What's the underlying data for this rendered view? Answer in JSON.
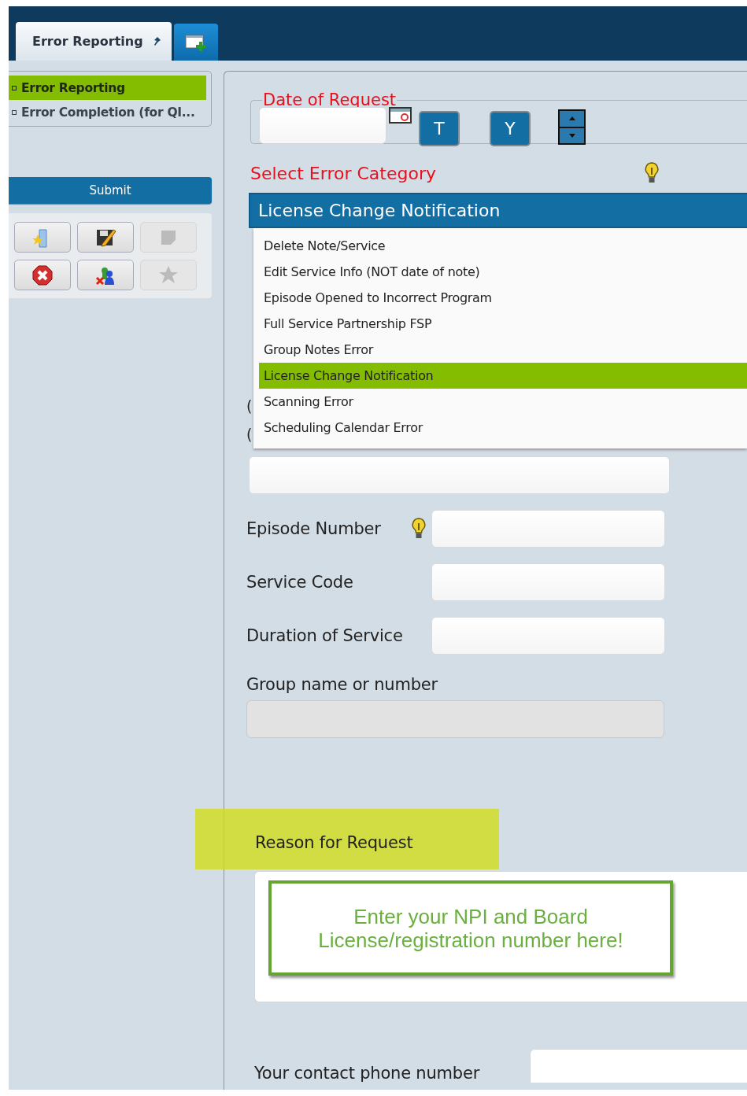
{
  "tabs": [
    {
      "label": "Error Reporting",
      "selected": true,
      "pinned": true
    }
  ],
  "nav": {
    "items": [
      {
        "label": "Error Reporting",
        "selected": true
      },
      {
        "label": "Error Completion (for QI...",
        "selected": false
      }
    ]
  },
  "submit_button": "Submit",
  "toolbar": [
    {
      "kind": "open",
      "disabled": false
    },
    {
      "kind": "save",
      "disabled": false
    },
    {
      "kind": "note",
      "disabled": true
    },
    {
      "kind": "delete",
      "disabled": false
    },
    {
      "kind": "unassign",
      "disabled": false
    },
    {
      "kind": "favorite",
      "disabled": true
    }
  ],
  "form": {
    "date": {
      "label": "Date of Request",
      "today_button": "T",
      "yesterday_button": "Y"
    },
    "category": {
      "label": "Select Error Category",
      "hint": true,
      "value": "License Change Notification",
      "expanded": true,
      "options": [
        {
          "label": "Delete Note/Service",
          "selected": false
        },
        {
          "label": "Edit Service Info (NOT date of note)",
          "selected": false
        },
        {
          "label": "Episode Opened to Incorrect Program",
          "selected": false
        },
        {
          "label": "Full Service Partnership FSP",
          "selected": false
        },
        {
          "label": "Group Notes Error",
          "selected": false
        },
        {
          "label": "License Change Notification",
          "selected": true
        },
        {
          "label": "Scanning Error",
          "selected": false
        },
        {
          "label": "Scheduling Calendar Error",
          "selected": false
        }
      ]
    },
    "covered_labels": [
      "(",
      "("
    ],
    "fields": [
      {
        "kind": "wide",
        "disabled": false
      },
      {
        "kind": "inline",
        "label": "Episode Number",
        "hint": true,
        "disabled": false
      },
      {
        "kind": "inline",
        "label": "Service Code",
        "hint": false,
        "disabled": false
      },
      {
        "kind": "inline",
        "label": "Duration of Service",
        "hint": false,
        "disabled": false
      },
      {
        "kind": "stacked",
        "label": "Group name or number",
        "hint": false,
        "disabled": true
      }
    ],
    "reason": {
      "label": "Reason for Request",
      "callout": "Enter your NPI and Board License/registration number here!"
    },
    "contact": {
      "label": "Your contact phone number"
    }
  }
}
